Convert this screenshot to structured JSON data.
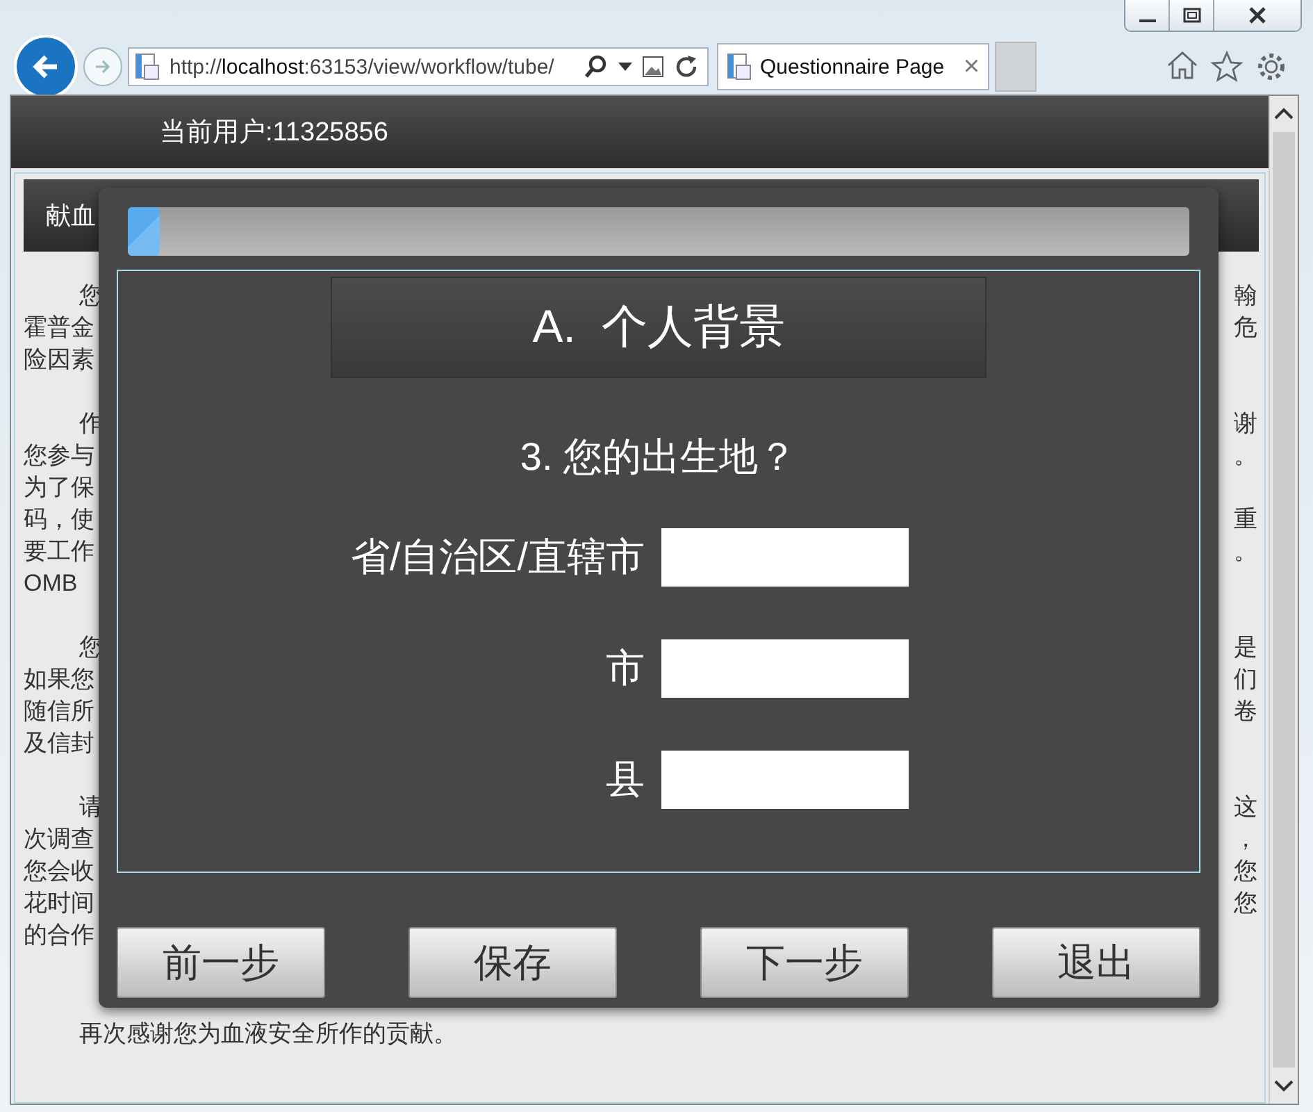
{
  "browser": {
    "address": "http://**localhost**:63153/view/workflow/tube/",
    "tab": {
      "title": "Questionnaire Page",
      "close": "×",
      "selected": true
    }
  },
  "page": {
    "user_label": "当前用户:11325856",
    "header": "献血",
    "paragraphs": [
      [
        {
          "left": "您",
          "right": "翰"
        },
        {
          "left": "霍普金",
          "right": "危"
        },
        {
          "left": "险因素"
        }
      ],
      [
        {
          "left": "作",
          "right": "谢"
        },
        {
          "left": "您参与",
          "right": "。"
        },
        {
          "left": "为了保"
        },
        {
          "left": "码，使",
          "right": "重"
        },
        {
          "left": "要工作",
          "right": "。"
        },
        {
          "left": "OMB"
        }
      ],
      [
        {
          "left": "您",
          "right": "是"
        },
        {
          "left": "如果您",
          "right": "们"
        },
        {
          "left": "随信所",
          "right": "卷"
        },
        {
          "left": "及信封"
        }
      ],
      [
        {
          "left": "请",
          "right": "这"
        },
        {
          "left": "次调查",
          "right": "，"
        },
        {
          "left": "您会收",
          "right": "您"
        },
        {
          "left": "花时间",
          "right": "您"
        },
        {
          "left": "的合作"
        }
      ]
    ],
    "closing": "再次感谢您为血液安全所作的贡献。"
  },
  "dialog": {
    "progress": {
      "level": 0.03
    },
    "section": "A.  个人背景",
    "question": "3. 您的出生地？",
    "fields": [
      {
        "label": "省/自治区/直辖市"
      },
      {
        "label": "市"
      },
      {
        "label": "县"
      }
    ],
    "buttons": [
      "前一步",
      "保存",
      "下一步",
      "退出"
    ]
  }
}
